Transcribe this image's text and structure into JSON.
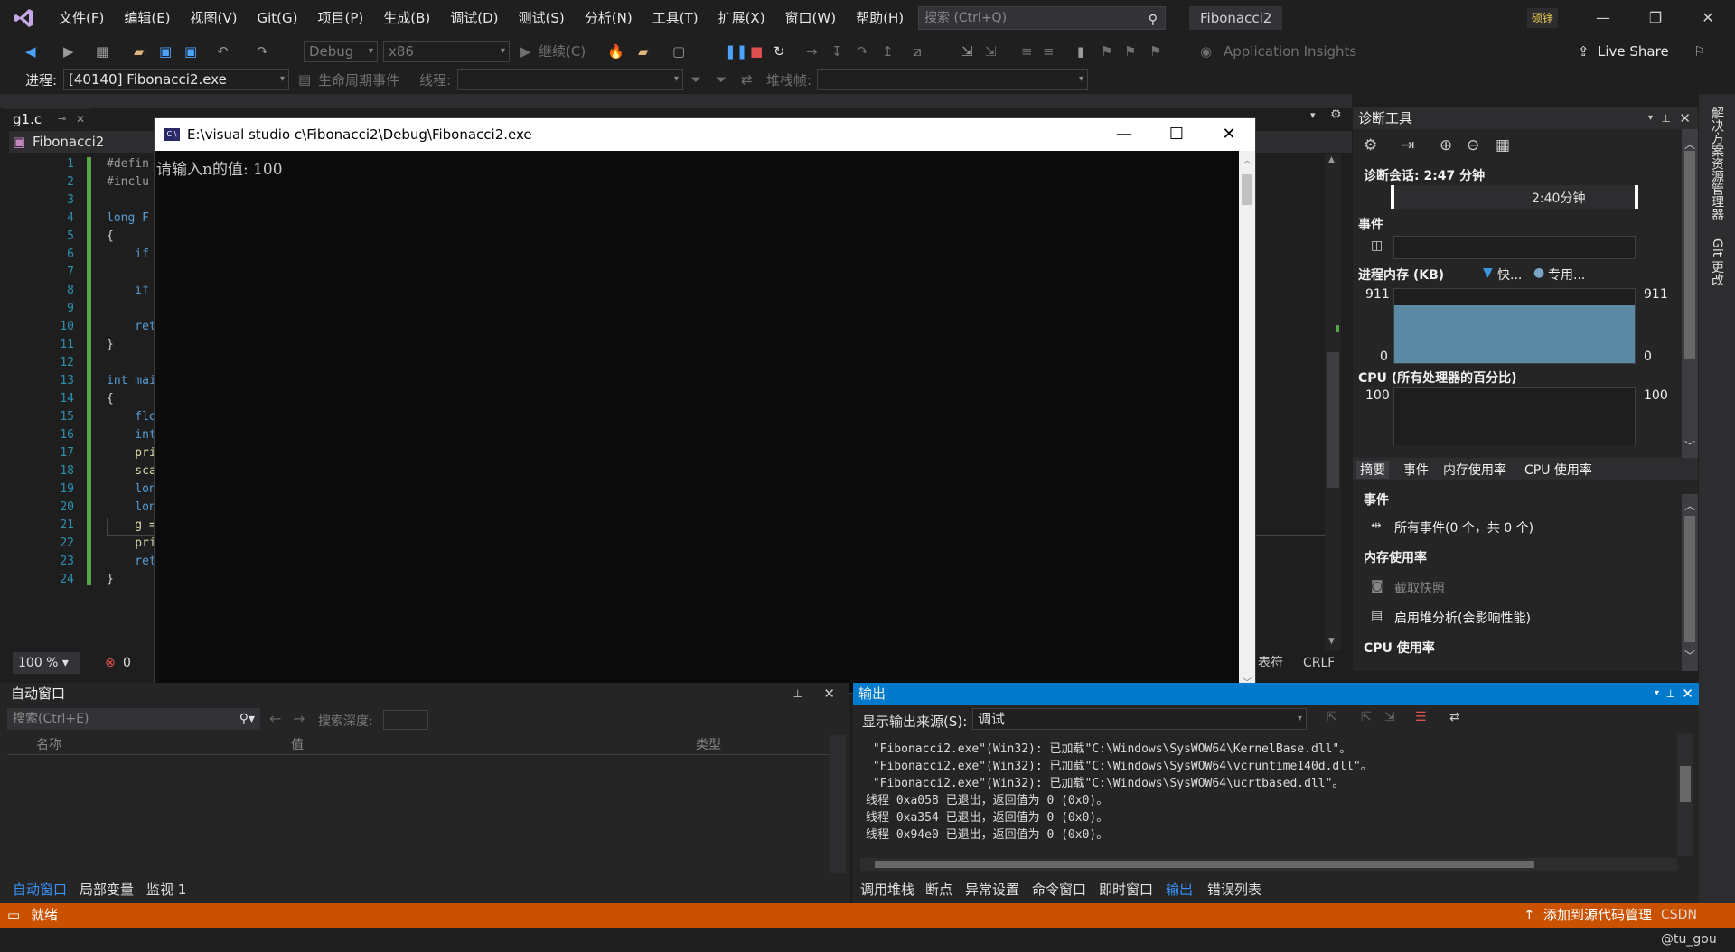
{
  "menu": {
    "items": [
      "文件(F)",
      "编辑(E)",
      "视图(V)",
      "Git(G)",
      "项目(P)",
      "生成(B)",
      "调试(D)",
      "测试(S)",
      "分析(N)",
      "工具(T)",
      "扩展(X)",
      "窗口(W)",
      "帮助(H)"
    ],
    "search_placeholder": "搜索 (Ctrl+Q)",
    "solution_name": "Fibonacci2",
    "user_badge": "硕铮"
  },
  "toolbar": {
    "config": "Debug",
    "platform": "x86",
    "continue_label": "继续(C)",
    "insights_label": "Application Insights",
    "live_share_label": "Live Share",
    "process_label": "进程:",
    "process_value": "[40140] Fibonacci2.exe",
    "lifecycle_label": "生命周期事件",
    "thread_label": "线程:",
    "stackframe_label": "堆栈帧:"
  },
  "editor": {
    "tab_name": "g1.c",
    "nav_scope": "Fibonacci2",
    "lines": [
      {
        "n": "1",
        "code": "#defin"
      },
      {
        "n": "2",
        "code": "#inclu"
      },
      {
        "n": "3",
        "code": ""
      },
      {
        "n": "4",
        "code": "long F"
      },
      {
        "n": "5",
        "code": "{"
      },
      {
        "n": "6",
        "code": "    if"
      },
      {
        "n": "7",
        "code": ""
      },
      {
        "n": "8",
        "code": "    if"
      },
      {
        "n": "9",
        "code": ""
      },
      {
        "n": "10",
        "code": "    ret"
      },
      {
        "n": "11",
        "code": "}"
      },
      {
        "n": "12",
        "code": ""
      },
      {
        "n": "13",
        "code": "int mai"
      },
      {
        "n": "14",
        "code": "{"
      },
      {
        "n": "15",
        "code": "    flo"
      },
      {
        "n": "16",
        "code": "    int"
      },
      {
        "n": "17",
        "code": "    pri"
      },
      {
        "n": "18",
        "code": "    sca"
      },
      {
        "n": "19",
        "code": "    lon"
      },
      {
        "n": "20",
        "code": "    lon"
      },
      {
        "n": "21",
        "code": "    g ="
      },
      {
        "n": "22",
        "code": "    pri"
      },
      {
        "n": "23",
        "code": "    ret"
      },
      {
        "n": "24",
        "code": "}"
      }
    ],
    "zoom": "100 %",
    "error_count": "0",
    "encoding_label": "表符",
    "line_ending": "CRLF"
  },
  "console": {
    "title": "E:\\visual studio c\\Fibonacci2\\Debug\\Fibonacci2.exe",
    "text": "请输入n的值: 100",
    "icon_label": "C:\\"
  },
  "diagnostics": {
    "title": "诊断工具",
    "session": "诊断会话: 2:47 分钟",
    "timeline_tick": "2:40分钟",
    "events_label": "事件",
    "memory_label": "进程内存 (KB)",
    "memory_legend_1": "快...",
    "memory_legend_2": "专用...",
    "memory_max": "911",
    "memory_min": "0",
    "cpu_label": "CPU (所有处理器的百分比)",
    "cpu_max": "100",
    "tabs": [
      "摘要",
      "事件",
      "内存使用率",
      "CPU 使用率"
    ],
    "summary_events_heading": "事件",
    "all_events": "所有事件(0 个，共 0 个)",
    "memory_heading": "内存使用率",
    "snapshot": "截取快照",
    "heap_profiling": "启用堆分析(会影响性能)",
    "cpu_heading": "CPU 使用率"
  },
  "autos": {
    "title": "自动窗口",
    "search_placeholder": "搜索(Ctrl+E)",
    "depth_label": "搜索深度:",
    "columns": [
      "名称",
      "值",
      "类型"
    ],
    "tabs": [
      "自动窗口",
      "局部变量",
      "监视 1"
    ]
  },
  "output": {
    "title": "输出",
    "source_label": "显示输出来源(S):",
    "source_value": "调试",
    "lines": [
      " \"Fibonacci2.exe\"(Win32): 已加载\"C:\\Windows\\SysWOW64\\KernelBase.dll\"。",
      " \"Fibonacci2.exe\"(Win32): 已加载\"C:\\Windows\\SysWOW64\\vcruntime140d.dll\"。",
      " \"Fibonacci2.exe\"(Win32): 已加载\"C:\\Windows\\SysWOW64\\ucrtbased.dll\"。",
      "线程 0xa058 已退出，返回值为 0 (0x0)。",
      "线程 0xa354 已退出，返回值为 0 (0x0)。",
      "线程 0x94e0 已退出，返回值为 0 (0x0)。"
    ],
    "tabs": [
      "调用堆栈",
      "断点",
      "异常设置",
      "命令窗口",
      "即时窗口",
      "输出",
      "错误列表"
    ]
  },
  "right_strip": {
    "items": [
      "解决方案资源管理器",
      "Git 更改"
    ]
  },
  "status": {
    "ready": "就绪",
    "source_control": "添加到源代码管理",
    "watermark": "CSDN @tu_gou"
  },
  "colors": {
    "accent": "#007acc",
    "status_bar": "#ca5100",
    "editor_bg": "#1e1e1e",
    "line_numbers": "#2b91af"
  }
}
